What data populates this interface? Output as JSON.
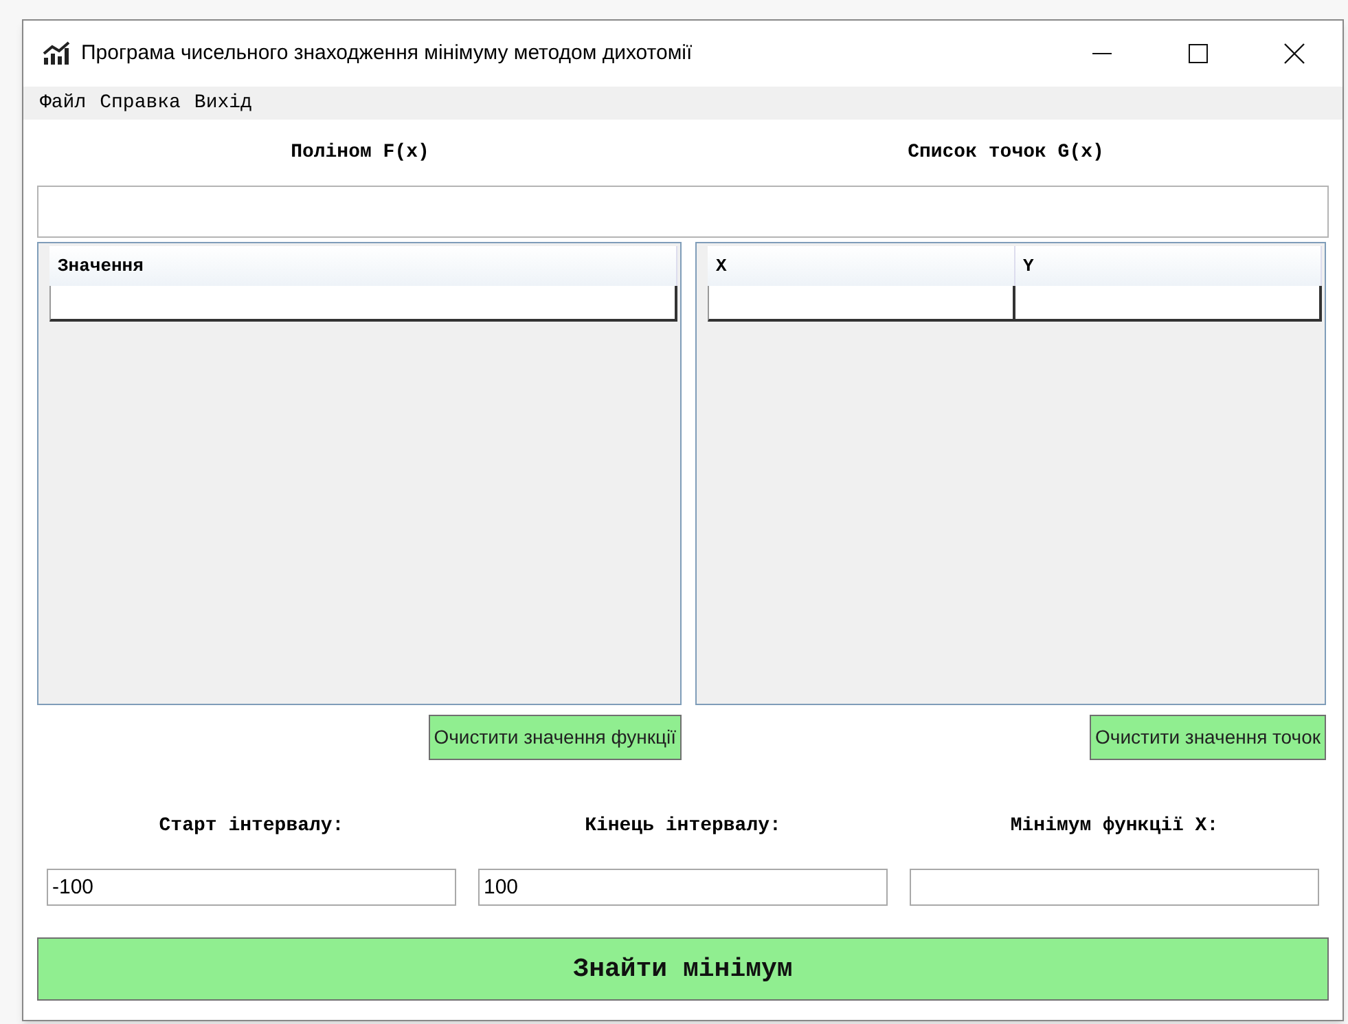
{
  "window": {
    "title": "Програма чисельного знаходження мінімуму методом дихотомії"
  },
  "menu": [
    "Файл",
    "Справка",
    "Вихід"
  ],
  "headings": [
    "Поліном F(x)",
    "Список точок G(x)"
  ],
  "values_grid": {
    "columns": [
      "Значення"
    ]
  },
  "points_grid": {
    "columns": [
      "X",
      "Y"
    ]
  },
  "clear_buttons": [
    "Очистити значення функції",
    "Очистити значення точок"
  ],
  "interval": [
    {
      "label": "Старт інтервалу:",
      "value": "-100"
    },
    {
      "label": "Кінець інтервалу:",
      "value": "100"
    },
    {
      "label": "Мінімум функції X:"
    }
  ],
  "find_button": "Знайти мінімум"
}
